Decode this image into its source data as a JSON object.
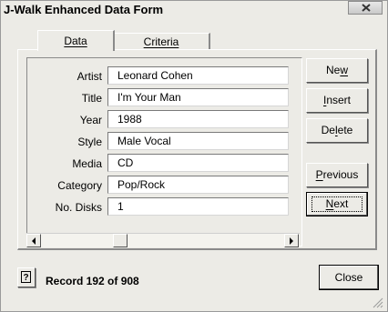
{
  "window": {
    "title": "J-Walk Enhanced Data Form"
  },
  "tabs": [
    {
      "label": "Data",
      "selected": true
    },
    {
      "label": "Criteria",
      "selected": false
    }
  ],
  "fields": [
    {
      "label": "Artist",
      "value": "Leonard Cohen"
    },
    {
      "label": "Title",
      "value": "I'm Your Man"
    },
    {
      "label": "Year",
      "value": "1988"
    },
    {
      "label": "Style",
      "value": "Male Vocal"
    },
    {
      "label": "Media",
      "value": "CD"
    },
    {
      "label": "Category",
      "value": "Pop/Rock"
    },
    {
      "label": "No. Disks",
      "value": "1"
    }
  ],
  "buttons": {
    "new": {
      "pre": "Ne",
      "accel": "w",
      "post": ""
    },
    "insert": {
      "pre": "",
      "accel": "I",
      "post": "nsert"
    },
    "delete": {
      "pre": "De",
      "accel": "l",
      "post": "ete"
    },
    "previous": {
      "pre": "",
      "accel": "P",
      "post": "revious"
    },
    "next": {
      "pre": "",
      "accel": "N",
      "post": "ext"
    },
    "close": "Close"
  },
  "status": {
    "record_text": "Record 192 of 908"
  },
  "icons": {
    "help": "?"
  }
}
